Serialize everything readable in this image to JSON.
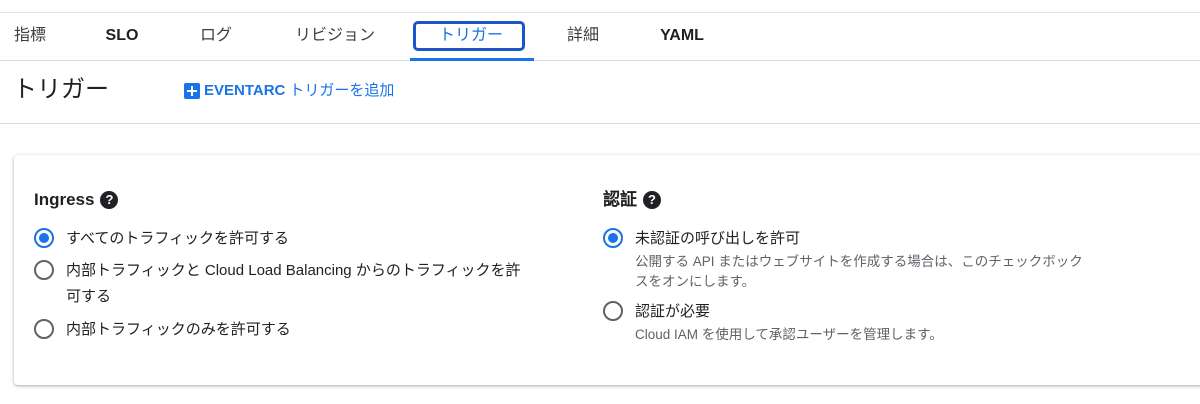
{
  "tabs": [
    {
      "label": "指標"
    },
    {
      "label": "SLO"
    },
    {
      "label": "ログ"
    },
    {
      "label": "リビジョン"
    },
    {
      "label": "トリガー"
    },
    {
      "label": "詳細"
    },
    {
      "label": "YAML"
    }
  ],
  "header": {
    "title": "トリガー",
    "add_button_cap": "EVENTARC",
    "add_button_rest": "トリガーを追加"
  },
  "ingress": {
    "title": "Ingress",
    "help": "?",
    "options": [
      {
        "label": "すべてのトラフィックを許可する",
        "checked": true
      },
      {
        "label_line1": "内部トラフィックと Cloud Load Balancing からのトラフィックを許",
        "label_line2": "可する",
        "checked": false
      },
      {
        "label": "内部トラフィックのみを許可する",
        "checked": false
      }
    ]
  },
  "auth": {
    "title": "認証",
    "help": "?",
    "options": [
      {
        "label": "未認証の呼び出しを許可",
        "desc_line1": "公開する API またはウェブサイトを作成する場合は、このチェックボック",
        "desc_line2": "スをオンにします。",
        "checked": true
      },
      {
        "label": "認証が必要",
        "desc": "Cloud IAM を使用して承認ユーザーを管理します。",
        "checked": false
      }
    ]
  },
  "colors": {
    "accent": "#1a73e8",
    "focus_ring": "#1a56c9",
    "text": "#202124",
    "secondary_text": "#5f6368"
  }
}
